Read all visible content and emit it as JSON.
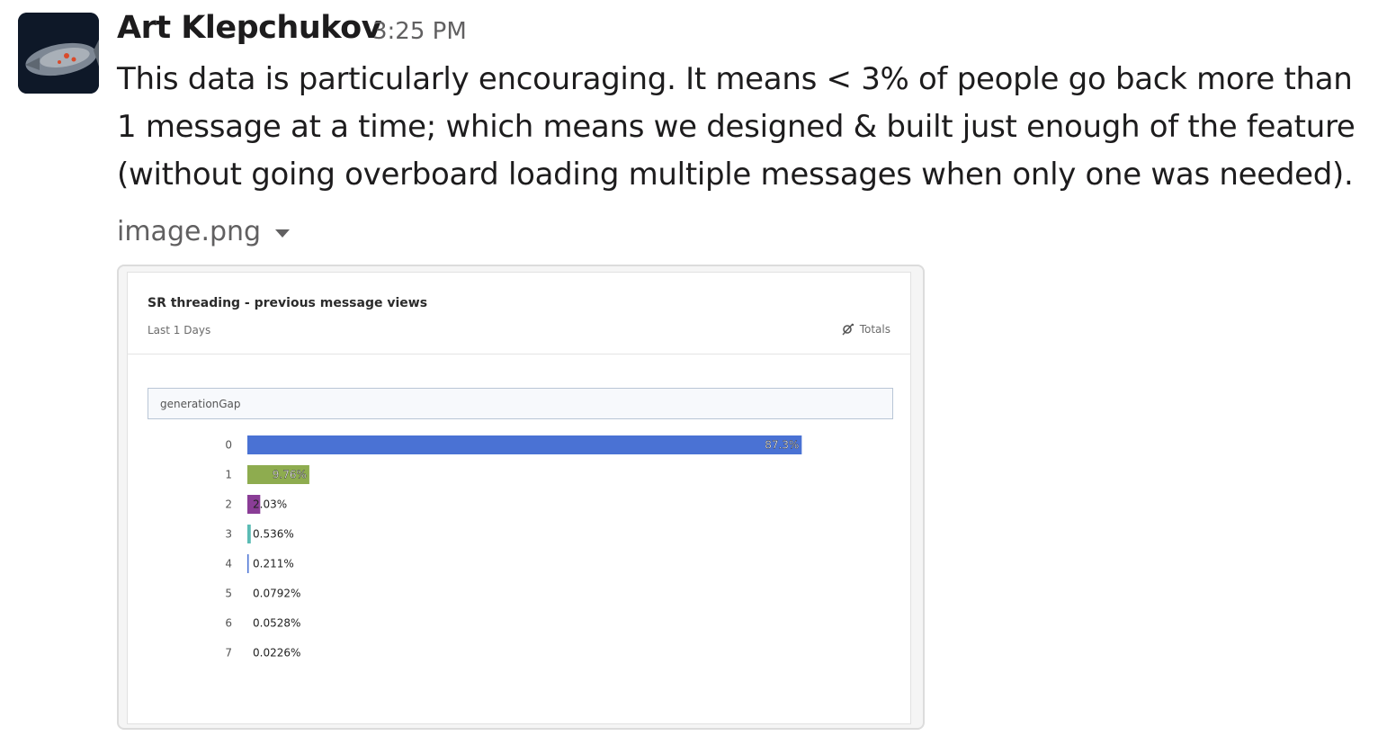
{
  "message": {
    "sender": "Art Klepchukov",
    "timestamp": "3:25 PM",
    "text": "This data is particularly encouraging. It means < 3% of people go back more than 1 message at a time; which means we designed & built just enough of the feature (without going overboard loading multiple messages when only one was needed)."
  },
  "attachment": {
    "filename": "image.png",
    "menu_icon": "chevron-down-icon"
  },
  "report": {
    "title": "SR threading - previous message views",
    "subtitle": "Last 1 Days",
    "totals_label": "Totals",
    "totals_icon": "settings-gear-icon",
    "group_by": "generationGap"
  },
  "chart_data": {
    "type": "bar",
    "orientation": "horizontal",
    "categories": [
      "0",
      "1",
      "2",
      "3",
      "4",
      "5",
      "6",
      "7"
    ],
    "values": [
      87.3,
      9.76,
      2.03,
      0.536,
      0.211,
      0.0792,
      0.0528,
      0.0226
    ],
    "labels": [
      "87.3%",
      "9.76%",
      "2.03%",
      "0.536%",
      "0.211%",
      "0.0792%",
      "0.0528%",
      "0.0226%"
    ],
    "colors": [
      "#4a72d4",
      "#8eac4f",
      "#8a3d96",
      "#5bbbb4",
      "#4a72d4",
      "#4a72d4",
      "#4a72d4",
      "#4a72d4"
    ],
    "xlim": [
      0,
      100
    ],
    "grid": false,
    "legend": "none"
  }
}
